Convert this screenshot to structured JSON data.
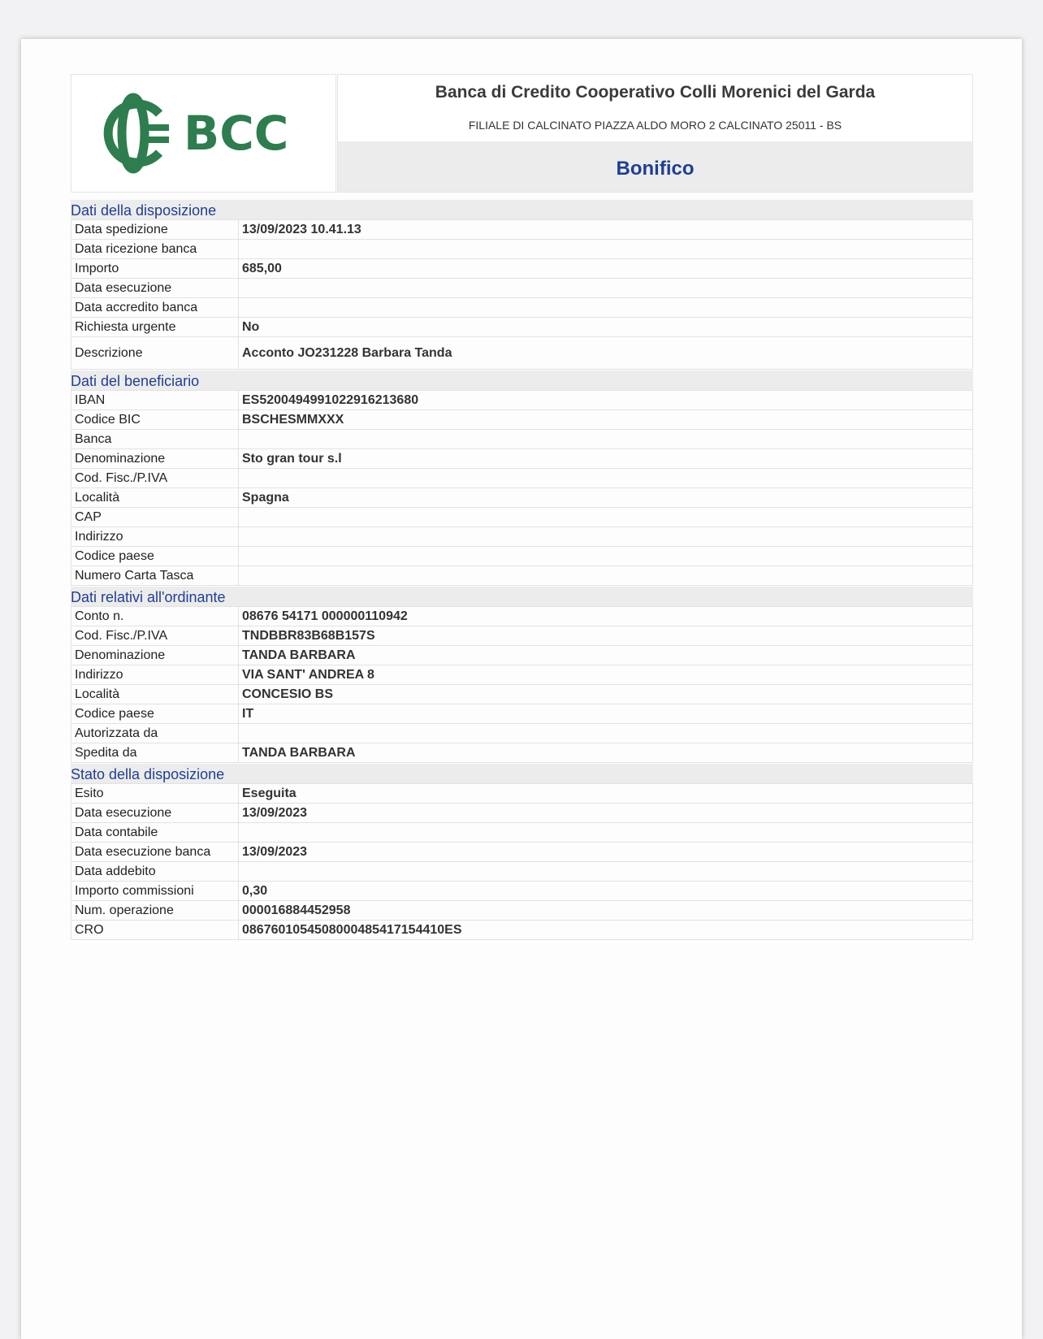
{
  "header": {
    "logo_text": "BCC",
    "bank_name": "Banca di Credito Cooperativo Colli Morenici del Garda",
    "branch": "FILIALE DI CALCINATO PIAZZA ALDO MORO 2 CALCINATO 25011 - BS",
    "document_type": "Bonifico"
  },
  "colors": {
    "accent_blue": "#1f3f95",
    "logo_green": "#2e7d4f",
    "band_gray": "#ececec"
  },
  "sections": [
    {
      "title": "Dati della disposizione",
      "rows": [
        {
          "label": "Data spedizione",
          "value": "13/09/2023 10.41.13"
        },
        {
          "label": "Data ricezione banca",
          "value": ""
        },
        {
          "label": "Importo",
          "value": "685,00"
        },
        {
          "label": "Data esecuzione",
          "value": ""
        },
        {
          "label": "Data accredito banca",
          "value": ""
        },
        {
          "label": "Richiesta urgente",
          "value": "No"
        },
        {
          "label": "Descrizione",
          "value": "Acconto  JO231228 Barbara Tanda"
        }
      ]
    },
    {
      "title": "Dati del beneficiario",
      "rows": [
        {
          "label": "IBAN",
          "value": "ES5200494991022916213680"
        },
        {
          "label": "Codice BIC",
          "value": "BSCHESMMXXX"
        },
        {
          "label": "Banca",
          "value": ""
        },
        {
          "label": "Denominazione",
          "value": "Sto gran tour s.l"
        },
        {
          "label": "Cod. Fisc./P.IVA",
          "value": ""
        },
        {
          "label": "Località",
          "value": "Spagna"
        },
        {
          "label": "CAP",
          "value": ""
        },
        {
          "label": "Indirizzo",
          "value": ""
        },
        {
          "label": "Codice paese",
          "value": ""
        },
        {
          "label": "Numero Carta Tasca",
          "value": ""
        }
      ]
    },
    {
      "title": "Dati relativi all'ordinante",
      "rows": [
        {
          "label": "Conto n.",
          "value": "08676 54171 000000110942"
        },
        {
          "label": "Cod. Fisc./P.IVA",
          "value": "TNDBBR83B68B157S"
        },
        {
          "label": "Denominazione",
          "value": "TANDA BARBARA"
        },
        {
          "label": "Indirizzo",
          "value": "VIA SANT' ANDREA 8"
        },
        {
          "label": "Località",
          "value": "CONCESIO BS"
        },
        {
          "label": "Codice paese",
          "value": "IT"
        },
        {
          "label": "Autorizzata da",
          "value": ""
        },
        {
          "label": "Spedita da",
          "value": "TANDA BARBARA"
        }
      ]
    },
    {
      "title": "Stato della disposizione",
      "rows": [
        {
          "label": "Esito",
          "value": "Eseguita"
        },
        {
          "label": "Data esecuzione",
          "value": "13/09/2023"
        },
        {
          "label": "Data contabile",
          "value": ""
        },
        {
          "label": "Data esecuzione banca",
          "value": "13/09/2023"
        },
        {
          "label": "Data addebito",
          "value": ""
        },
        {
          "label": "Importo commissioni",
          "value": "0,30"
        },
        {
          "label": "Num. operazione",
          "value": "000016884452958"
        },
        {
          "label": "CRO",
          "value": "0867601054508000485417154410ES"
        }
      ]
    }
  ]
}
